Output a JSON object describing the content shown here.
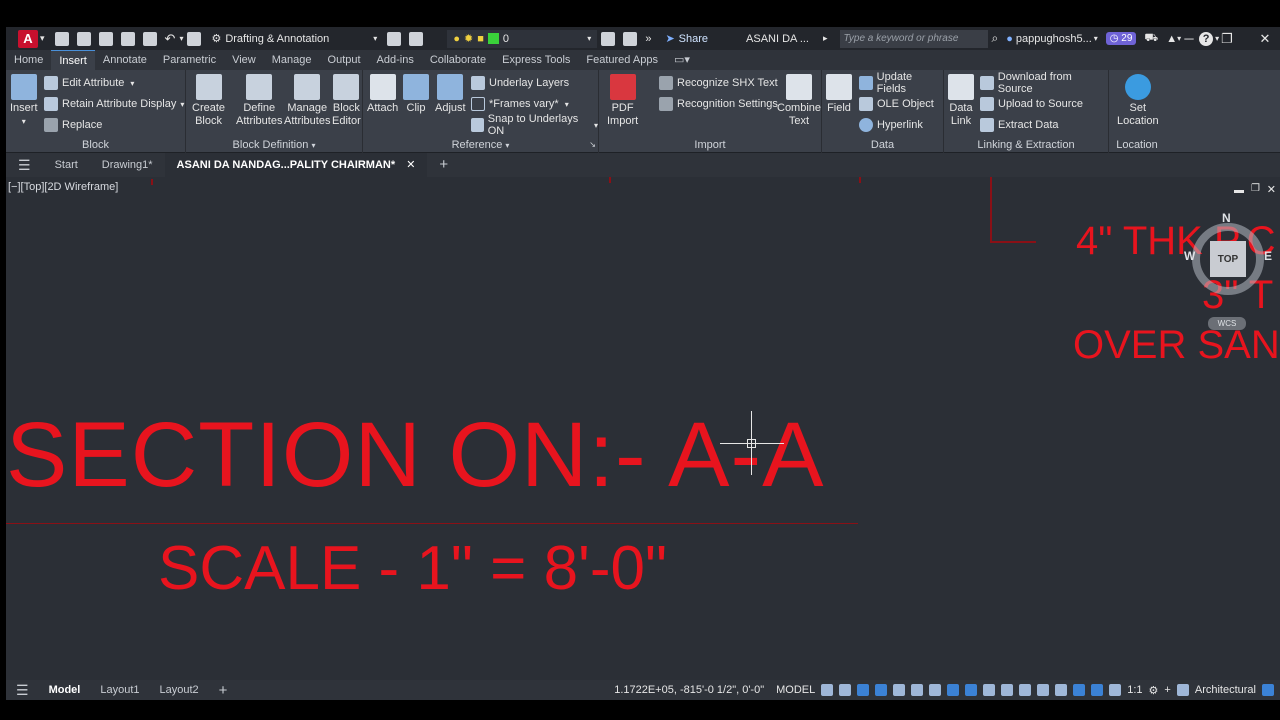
{
  "titlebar": {
    "logo": "A",
    "workspace": "Drafting & Annotation",
    "layer_value": "0",
    "share": "Share",
    "doc_title": "ASANI DA ...",
    "search_placeholder": "Type a keyword or phrase",
    "user": "pappughosh5...",
    "badge": "29"
  },
  "tabs": [
    "Home",
    "Insert",
    "Annotate",
    "Parametric",
    "View",
    "Manage",
    "Output",
    "Add-ins",
    "Collaborate",
    "Express Tools",
    "Featured Apps"
  ],
  "active_tab": "Insert",
  "ribbon": {
    "block": {
      "title": "Block",
      "insert": "Insert",
      "edit_attribute": "Edit Attribute",
      "retain_attribute_display": "Retain Attribute Display",
      "replace": "Replace"
    },
    "block_definition": {
      "title": "Block Definition",
      "create_block_1": "Create",
      "create_block_2": "Block",
      "define_attributes_1": "Define",
      "define_attributes_2": "Attributes",
      "manage_attributes_1": "Manage",
      "manage_attributes_2": "Attributes",
      "block_editor_1": "Block",
      "block_editor_2": "Editor"
    },
    "reference": {
      "title": "Reference",
      "attach": "Attach",
      "clip": "Clip",
      "adjust": "Adjust",
      "underlay_layers": "Underlay Layers",
      "frames_vary": "*Frames vary*",
      "snap_to_underlays": "Snap to Underlays ON"
    },
    "import": {
      "title": "Import",
      "pdf_import_1": "PDF",
      "pdf_import_2": "Import",
      "recognize_shx": "Recognize SHX Text",
      "recognition_settings": "Recognition Settings",
      "combine_text_1": "Combine",
      "combine_text_2": "Text"
    },
    "data": {
      "title": "Data",
      "field": "Field",
      "update_fields": "Update Fields",
      "ole_object": "OLE Object",
      "hyperlink": "Hyperlink"
    },
    "linking": {
      "title": "Linking & Extraction",
      "data_link_1": "Data",
      "data_link_2": "Link",
      "download_from_source": "Download from Source",
      "upload_to_source": "Upload to Source",
      "extract_data": "Extract  Data"
    },
    "location": {
      "title": "Location",
      "set_location_1": "Set",
      "set_location_2": "Location"
    }
  },
  "file_tabs": {
    "start": "Start",
    "drawing1": "Drawing1*",
    "active": "ASANI DA NANDAG...PALITY CHAIRMAN*"
  },
  "viewport": {
    "label": "[−][Top][2D Wireframe]",
    "viewcube_top": "TOP",
    "compass_n": "N",
    "compass_w": "W",
    "compass_e": "E",
    "wcs": "WCS"
  },
  "drawing": {
    "section_title": "SECTION  ON:- A-A",
    "scale": "SCALE - 1\" = 8'-0\"",
    "note1": "4\" THK P.C",
    "note2": "3\" T",
    "note3": "OVER SAN",
    "text_color": "#e8141e"
  },
  "layout_tabs": [
    "Model",
    "Layout1",
    "Layout2"
  ],
  "active_layout": "Model",
  "status": {
    "coords": "1.1722E+05, -815'-0 1/2\", 0'-0\"",
    "model": "MODEL",
    "scale": "1:1",
    "units": "Architectural"
  }
}
